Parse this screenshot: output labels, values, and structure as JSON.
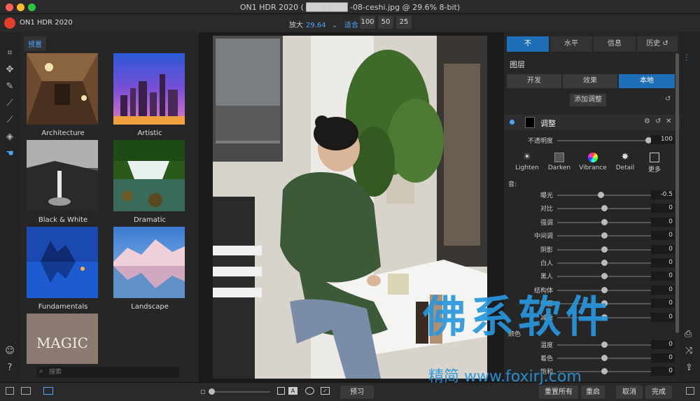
{
  "window": {
    "title": "ON1 HDR 2020 ( ███████ -08-ceshi.jpg @ 29.6% 8-bit)",
    "colors": {
      "close": "#ff5f57",
      "minimize": "#febc2e",
      "maximize": "#28c840"
    }
  },
  "toolbar": {
    "app_name": "ON1 HDR 2020",
    "zoom_label": "放大",
    "zoom_value": "29.64",
    "fit_label": "适合",
    "zoom_presets": [
      "100",
      "50",
      "25"
    ]
  },
  "browser": {
    "tab_label": "预置",
    "search_placeholder": "搜索",
    "presets": [
      {
        "label": "Architecture"
      },
      {
        "label": "Artistic"
      },
      {
        "label": "Black & White"
      },
      {
        "label": "Dramatic"
      },
      {
        "label": "Fundamentals"
      },
      {
        "label": "Landscape"
      },
      {
        "label": "MAGIC"
      }
    ]
  },
  "panel": {
    "tabs": [
      "不",
      "水平",
      "信息",
      "历史"
    ],
    "layers_title": "图层",
    "subtabs": [
      "开发",
      "效果",
      "本地"
    ],
    "add_adjustment": "添加调整",
    "adjust_title": "调整",
    "opacity_label": "不透明度",
    "opacity_value": "100",
    "preset_buttons": [
      "Lighten",
      "Darken",
      "Vibrance",
      "Detail",
      "更多"
    ],
    "tone_label": "音:",
    "sliders": [
      {
        "label": "曝光",
        "value": "-0.5",
        "pos": 0.46
      },
      {
        "label": "对比",
        "value": "0",
        "pos": 0.5
      },
      {
        "label": "强调",
        "value": "0",
        "pos": 0.5
      },
      {
        "label": "中间调",
        "value": "0",
        "pos": 0.5
      },
      {
        "label": "阴影",
        "value": "0",
        "pos": 0.5
      },
      {
        "label": "白人",
        "value": "0",
        "pos": 0.5
      },
      {
        "label": "黑人",
        "value": "0",
        "pos": 0.5
      },
      {
        "label": "结构体",
        "value": "0",
        "pos": 0.5
      },
      {
        "label": "阴霾",
        "value": "0",
        "pos": 0.5
      },
      {
        "label": "减噪",
        "value": "0",
        "pos": 0.5
      }
    ],
    "color_label": "颜色",
    "color_sliders": [
      {
        "label": "温度",
        "value": "0",
        "pos": 0.5
      },
      {
        "label": "着色",
        "value": "0",
        "pos": 0.5
      },
      {
        "label": "饱和",
        "value": "0",
        "pos": 0.5
      }
    ]
  },
  "bottom": {
    "preview": "预习",
    "reset_all": "重置所有",
    "restart": "重启",
    "cancel": "取消",
    "done": "完成"
  },
  "watermark": {
    "main": "佛系软件",
    "sub": "精简 www.foxirj.com"
  },
  "accent": "#1f6fb8"
}
